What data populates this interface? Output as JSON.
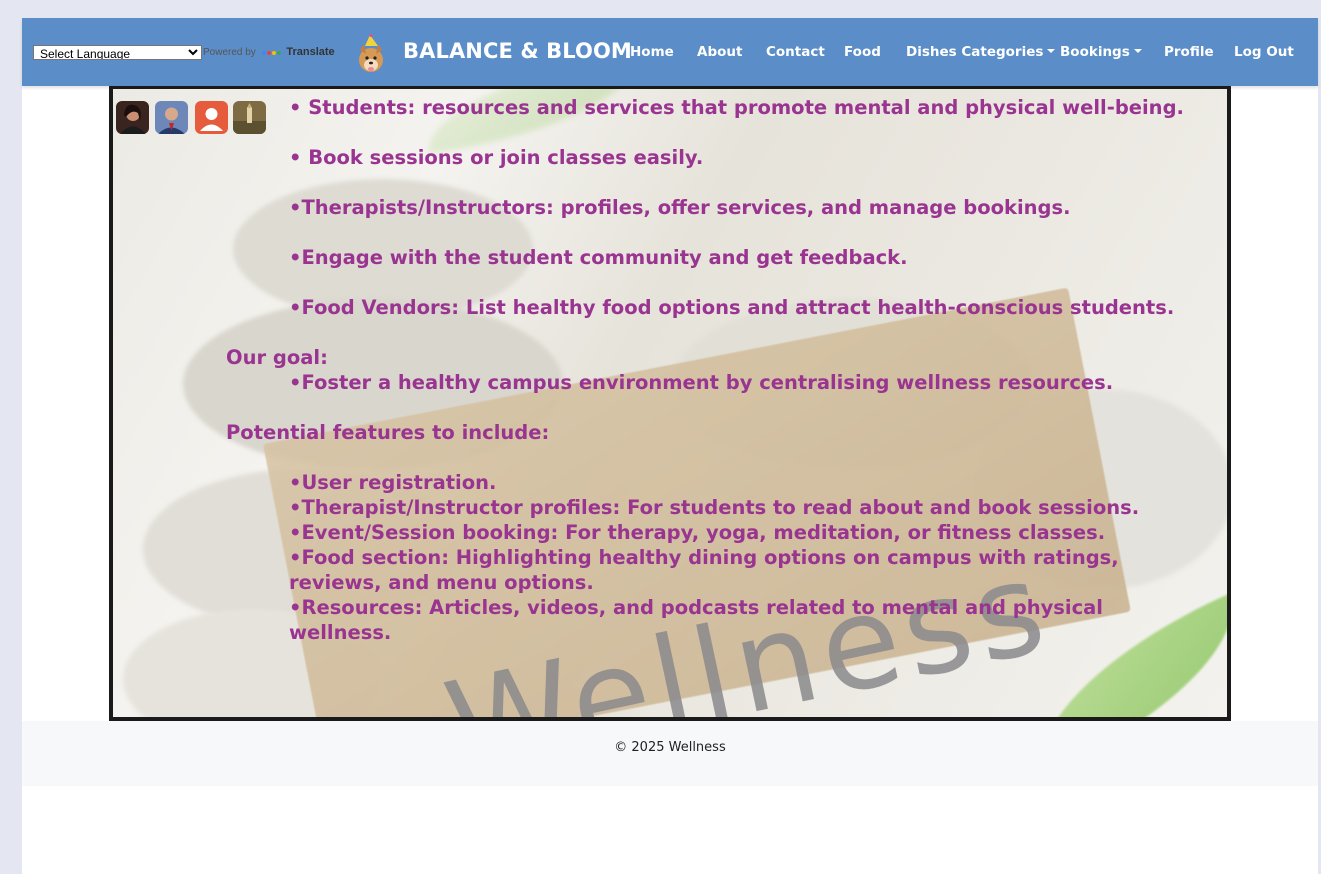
{
  "language_widget": {
    "select_value": "Select Language",
    "powered_by": "Powered by",
    "translate": "Translate"
  },
  "brand": {
    "name": "BALANCE & BLOOM",
    "logo_icon": "dog-party-hat-icon"
  },
  "nav": {
    "items": [
      {
        "label": "Home"
      },
      {
        "label": "About"
      },
      {
        "label": "Contact"
      },
      {
        "label": "Food"
      },
      {
        "label": "Dishes Categories",
        "dropdown": true
      },
      {
        "label": "Bookings",
        "dropdown": true
      },
      {
        "label": "Profile"
      },
      {
        "label": "Log Out"
      }
    ]
  },
  "hero": {
    "background_word": "Wellness",
    "lines": [
      "• Students: resources and services that promote mental and physical well-being.",
      "• Book sessions or join classes easily.",
      "•Therapists/Instructors: profiles, offer services, and manage bookings.",
      "•Engage with the student community and get feedback.",
      "•Food Vendors: List healthy food options and attract health-conscious students.",
      "Our goal:",
      "•Foster a healthy campus environment by centralising wellness resources.",
      "Potential features to include:",
      "•User registration.",
      "•Therapist/Instructor profiles: For students to read about and book sessions.",
      "•Event/Session booking: For therapy, yoga, meditation, or fitness classes.",
      "•Food section: Highlighting healthy dining options on campus with ratings,",
      "reviews, and menu options.",
      "•Resources: Articles, videos, and podcasts related to mental and physical",
      "wellness."
    ],
    "avatars": [
      "woman-portrait-avatar",
      "man-suit-avatar",
      "default-user-avatar",
      "landscape-avatar"
    ]
  },
  "colors": {
    "navbar": "#5b8ec8",
    "hero_text": "#9a3491",
    "footer_bg": "#f7f8f9"
  },
  "footer": {
    "text": "© 2025 Wellness"
  }
}
